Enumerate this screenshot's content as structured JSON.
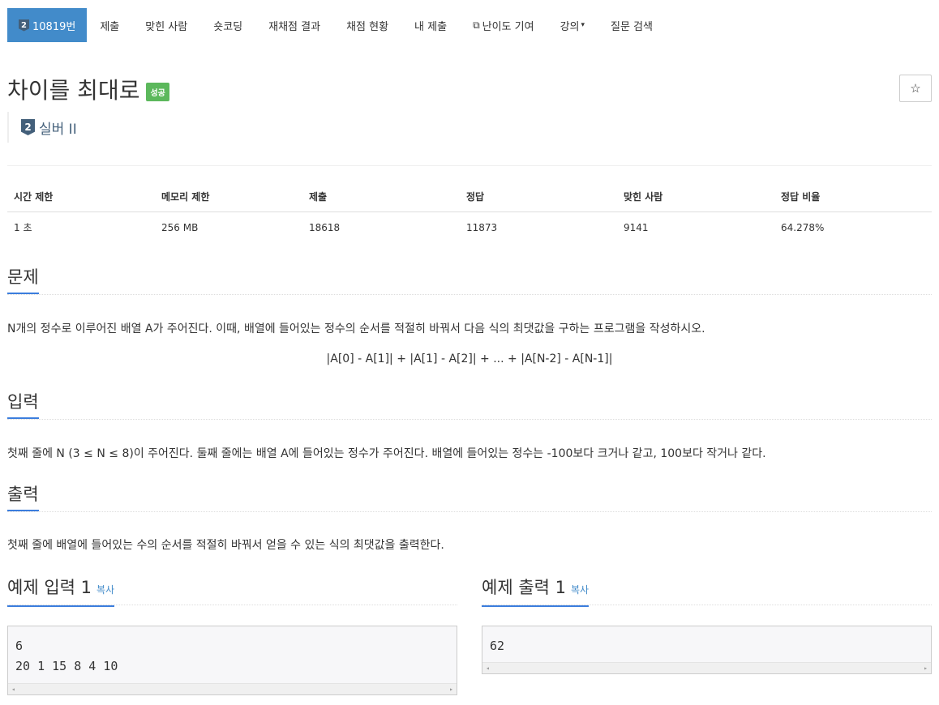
{
  "nav": {
    "problem_number": "10819번",
    "tier_digit": "2",
    "items": [
      "제출",
      "맞힌 사람",
      "숏코딩",
      "재채점 결과",
      "채점 현황",
      "내 제출",
      "난이도 기여",
      "강의",
      "질문 검색"
    ]
  },
  "problem": {
    "title": "차이를 최대로",
    "result": "성공",
    "tier_digit": "2",
    "tier": "실버 II"
  },
  "info_table": {
    "headers": [
      "시간 제한",
      "메모리 제한",
      "제출",
      "정답",
      "맞힌 사람",
      "정답 비율"
    ],
    "values": [
      "1 초",
      "256 MB",
      "18618",
      "11873",
      "9141",
      "64.278%"
    ]
  },
  "sections": {
    "problem_heading": "문제",
    "problem_text": "N개의 정수로 이루어진 배열 A가 주어진다. 이때, 배열에 들어있는 정수의 순서를 적절히 바꿔서 다음 식의 최댓값을 구하는 프로그램을 작성하시오.",
    "formula": "|A[0] - A[1]| + |A[1] - A[2]| + ... + |A[N-2] - A[N-1]|",
    "input_heading": "입력",
    "input_text": "첫째 줄에 N (3 ≤ N ≤ 8)이 주어진다. 둘째 줄에는 배열 A에 들어있는 정수가 주어진다. 배열에 들어있는 정수는 -100보다 크거나 같고, 100보다 작거나 같다.",
    "output_heading": "출력",
    "output_text": "첫째 줄에 배열에 들어있는 수의 순서를 적절히 바꿔서 얻을 수 있는 식의 최댓값을 출력한다."
  },
  "samples": {
    "input_heading": "예제 입력 1",
    "output_heading": "예제 출력 1",
    "copy_label": "복사",
    "input_line1": "6",
    "input_line2": "20 1 15 8 4 10",
    "output_line1": "62"
  },
  "icons": {
    "star": "☆",
    "external_link": "⧉",
    "caret": "▾",
    "scroll_left": "◂",
    "scroll_right": "▸"
  },
  "colors": {
    "nav_active_bg": "#428bca",
    "success_badge": "#5cb85c",
    "silver_tier": "#435f7a",
    "heading_underline": "#3b7ddd"
  }
}
